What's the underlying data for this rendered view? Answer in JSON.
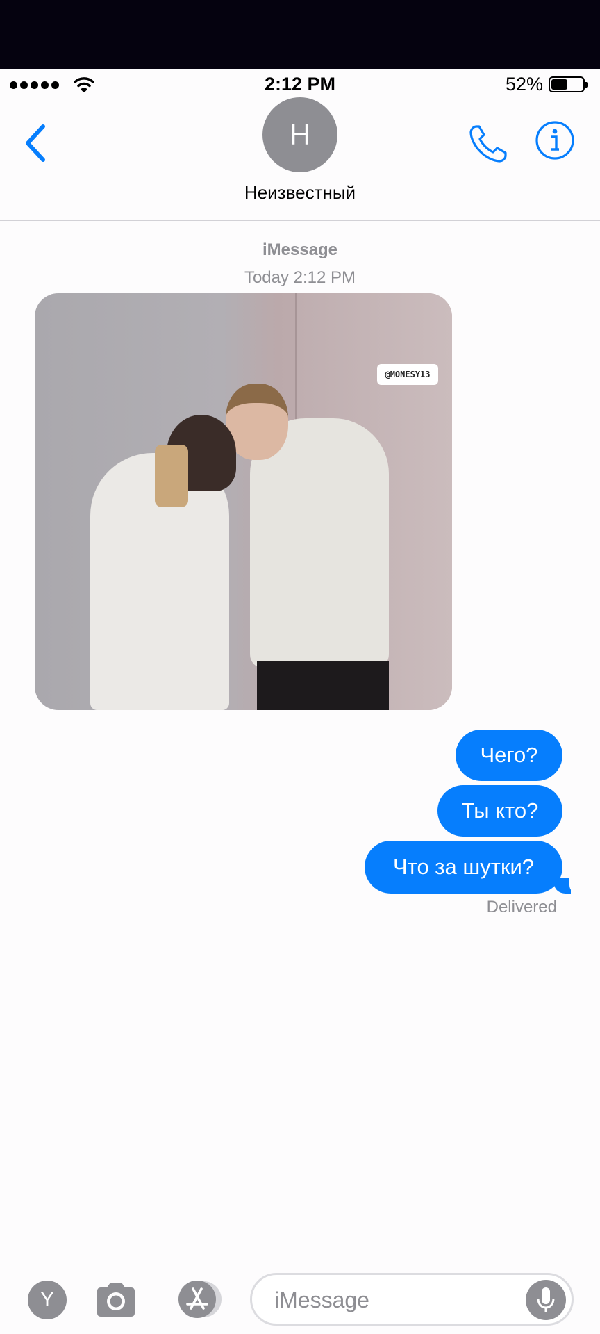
{
  "status_bar": {
    "time": "2:12 PM",
    "battery_percent": "52%",
    "battery_level": 0.52,
    "wifi_icon": "wifi-icon",
    "signal_icon": "signal-dots-icon"
  },
  "header": {
    "avatar_initial": "Н",
    "contact_name": "Неизвестный",
    "back_icon": "chevron-left-icon",
    "call_icon": "phone-icon",
    "info_icon": "info-icon"
  },
  "conversation": {
    "service": "iMessage",
    "timestamp": "Today 2:12 PM",
    "photo_watermark": "@MONESY13",
    "messages": [
      {
        "direction": "outgoing",
        "text": "Чего?"
      },
      {
        "direction": "outgoing",
        "text": "Ты кто?"
      },
      {
        "direction": "outgoing",
        "text": "Что за шутки?"
      }
    ],
    "delivery_status": "Delivered"
  },
  "input_bar": {
    "app_initial": "Y",
    "placeholder": "iMessage",
    "camera_icon": "camera-icon",
    "appstore_icon": "app-store-icon",
    "mic_icon": "microphone-icon"
  },
  "colors": {
    "accent": "#067efd",
    "gray": "#8e8e93",
    "top_band": "#05020f"
  }
}
